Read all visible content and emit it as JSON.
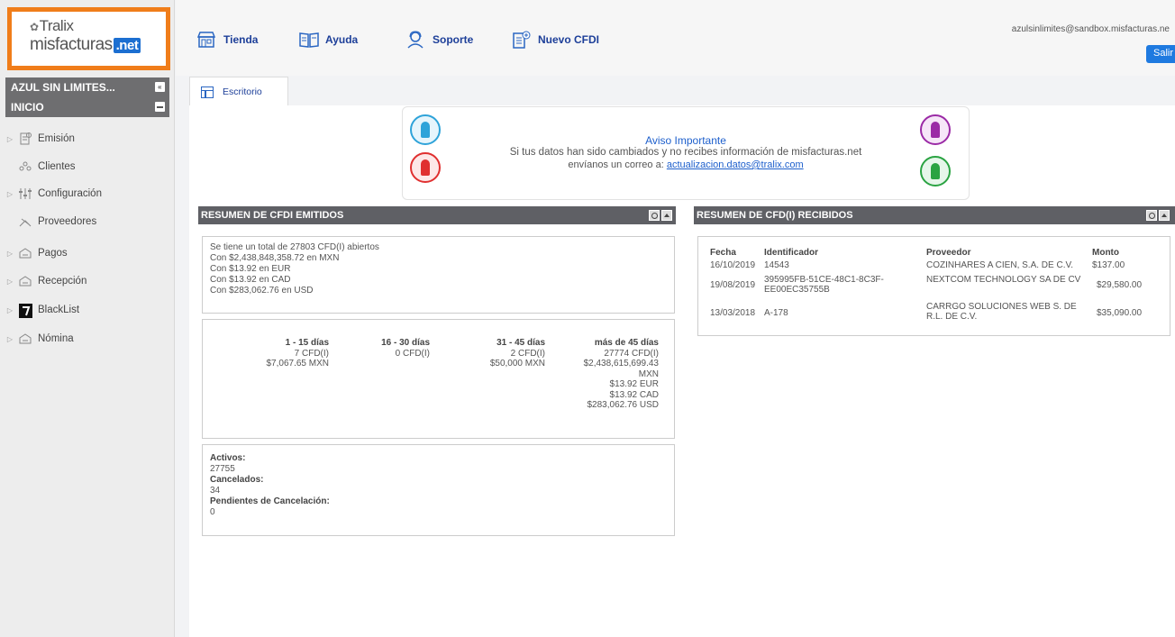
{
  "logo": {
    "brand": "Tralix",
    "product": "misfacturas",
    "tld": ".net"
  },
  "sidebar": {
    "account": "AZUL SIN LIMITES...",
    "section": "INICIO",
    "items": [
      {
        "label": "Emisión",
        "icon": "invoice-icon",
        "expandable": true
      },
      {
        "label": "Clientes",
        "icon": "clients-icon",
        "expandable": false
      },
      {
        "label": "Configuración",
        "icon": "settings-sliders-icon",
        "expandable": true
      },
      {
        "label": "Proveedores",
        "icon": "suppliers-icon",
        "expandable": false
      },
      {
        "label": "Pagos",
        "icon": "payments-icon",
        "expandable": true
      },
      {
        "label": "Recepción",
        "icon": "reception-icon",
        "expandable": true
      },
      {
        "label": "BlackList",
        "icon": "blacklist-icon",
        "expandable": true
      },
      {
        "label": "Nómina",
        "icon": "payroll-icon",
        "expandable": true
      }
    ]
  },
  "topbar": {
    "nav": [
      {
        "label": "Tienda",
        "icon": "store-icon"
      },
      {
        "label": "Ayuda",
        "icon": "help-book-icon"
      },
      {
        "label": "Soporte",
        "icon": "support-agent-icon"
      },
      {
        "label": "Nuevo CFDI",
        "icon": "new-document-icon"
      }
    ],
    "user_email": "azulsinlimites@sandbox.misfacturas.ne",
    "logout": "Salir"
  },
  "tab": {
    "label": "Escritorio"
  },
  "notice": {
    "title": "Aviso Importante",
    "line1": "Si tus datos han sido cambiados y no recibes información de misfacturas.net",
    "line2_prefix": "envíanos un correo a:",
    "email": "actualizacion.datos@tralix.com"
  },
  "emitidos": {
    "title": "RESUMEN DE CFDI EMITIDOS",
    "summary": [
      "Se tiene un total de 27803 CFD(I) abiertos",
      "Con $2,438,848,358.72 en MXN",
      "Con $13.92 en EUR",
      "Con $13.92 en CAD",
      "Con $283,062.76 en USD"
    ],
    "aging": [
      {
        "label": "1 - 15 días",
        "lines": [
          "7 CFD(I)",
          "$7,067.65 MXN"
        ]
      },
      {
        "label": "16 - 30 días",
        "lines": [
          "0 CFD(I)"
        ]
      },
      {
        "label": "31 - 45 días",
        "lines": [
          "2 CFD(I)",
          "$50,000 MXN"
        ]
      },
      {
        "label": "más de 45 días",
        "lines": [
          "27774 CFD(I)",
          "$2,438,615,699.43",
          "MXN",
          "$13.92 EUR",
          "$13.92 CAD",
          "$283,062.76 USD"
        ]
      }
    ],
    "status": {
      "activos_label": "Activos:",
      "activos": "27755",
      "cancelados_label": "Cancelados:",
      "cancelados": "34",
      "pendientes_label": "Pendientes de Cancelación:",
      "pendientes": "0"
    }
  },
  "recibidos": {
    "title": "RESUMEN DE CFD(I) RECIBIDOS",
    "columns": [
      "Fecha",
      "Identificador",
      "Proveedor",
      "Monto"
    ],
    "rows": [
      {
        "fecha": "16/10/2019",
        "id": "14543",
        "proveedor": "COZINHARES A CIEN, S.A. DE C.V.",
        "monto": "$137.00"
      },
      {
        "fecha": "19/08/2019",
        "id": "395995FB-51CE-48C1-8C3F-EE00EC35755B",
        "proveedor": "NEXTCOM TECHNOLOGY SA DE CV",
        "monto": "$29,580.00"
      },
      {
        "fecha": "13/03/2018",
        "id": "A-178",
        "proveedor": "CARRGO SOLUCIONES WEB S. DE R.L. DE C.V.",
        "monto": "$35,090.00"
      }
    ]
  }
}
